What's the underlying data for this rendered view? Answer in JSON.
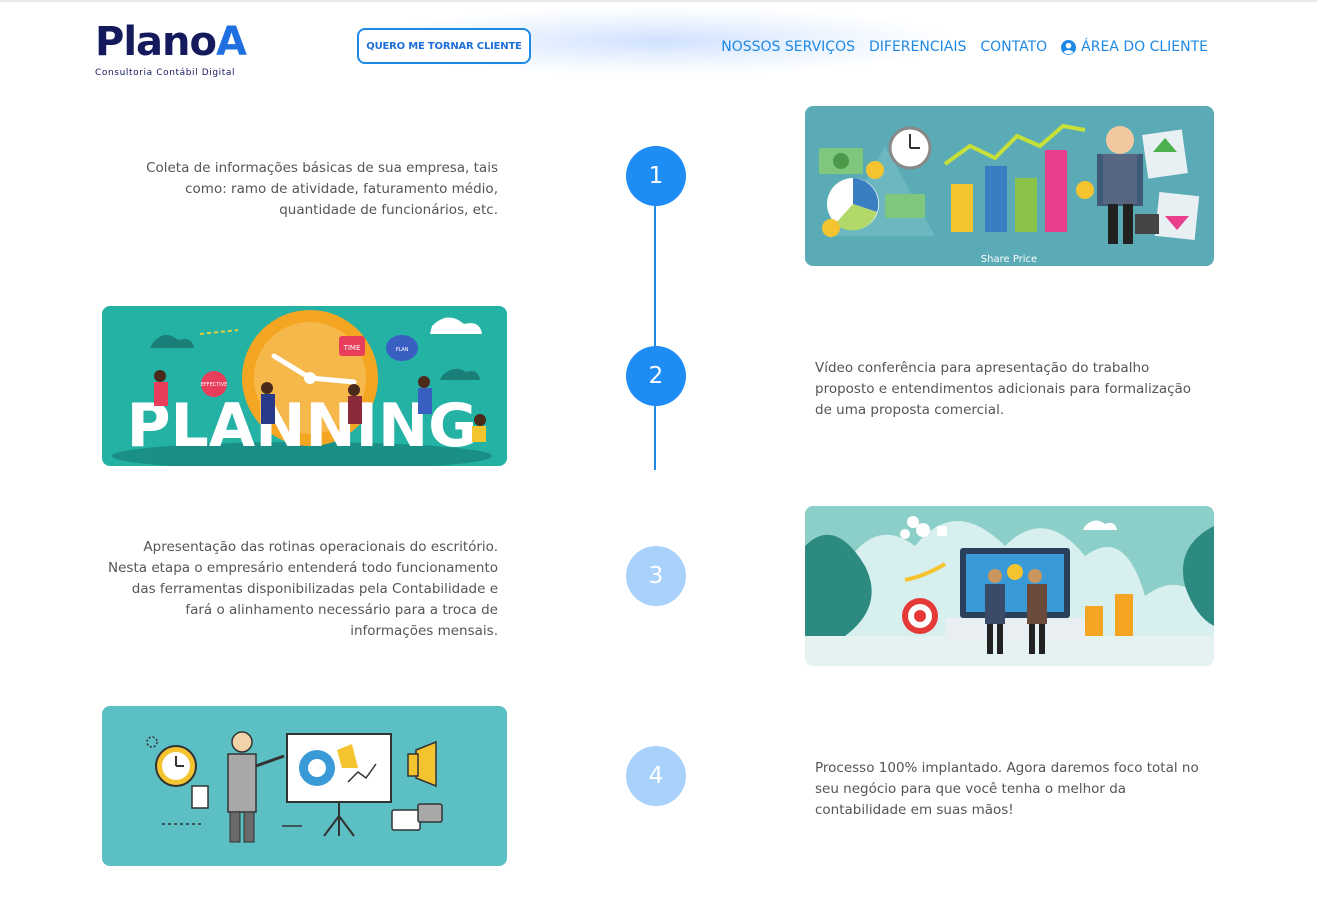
{
  "header": {
    "logo_main": "Plano",
    "logo_accent": "A",
    "logo_sub": "Consultoria Contábil Digital",
    "cta_label": "QUERO ME TORNAR CLIENTE",
    "nav": [
      {
        "label": "NOSSOS SERVIÇOS"
      },
      {
        "label": "DIFERENCIAIS"
      },
      {
        "label": "CONTATO"
      },
      {
        "label": "ÁREA DO CLIENTE",
        "icon": "user-circle-icon"
      }
    ]
  },
  "timeline": {
    "steps": [
      {
        "number": "1",
        "status": "active",
        "text": "Coleta de informações básicas de sua empresa, tais como: ramo de atividade, faturamento médio, quantidade de funcionários, etc.",
        "image_caption": "Share Price",
        "image_icon": "finance-chart-illustration-icon"
      },
      {
        "number": "2",
        "status": "active",
        "text": "Vídeo conferência para apresentação do trabalho proposto e entendimentos adicionais para formalização de uma proposta comercial.",
        "image_caption": "PLANNING",
        "image_icon": "planning-illustration-icon",
        "image_tags": [
          "TIME",
          "PLAN",
          "EFFECTIVE"
        ]
      },
      {
        "number": "3",
        "status": "inactive",
        "text": "Apresentação das rotinas operacionais do escritório. Nesta etapa o empresário entenderá todo funcionamento das ferramentas disponibilizadas pela Contabilidade e fará o alinhamento necessário para a troca de informações mensais.",
        "image_icon": "handshake-laptop-illustration-icon"
      },
      {
        "number": "4",
        "status": "inactive",
        "text": "Processo 100% implantado. Agora daremos foco total no seu negócio para que você tenha o melhor da contabilidade em suas mãos!",
        "image_icon": "presentation-illustration-icon"
      }
    ]
  },
  "colors": {
    "brand_dark": "#141a5b",
    "accent_blue": "#1e88e5",
    "circle_active": "#1e8cf5",
    "circle_inactive": "#a8d2fb"
  }
}
